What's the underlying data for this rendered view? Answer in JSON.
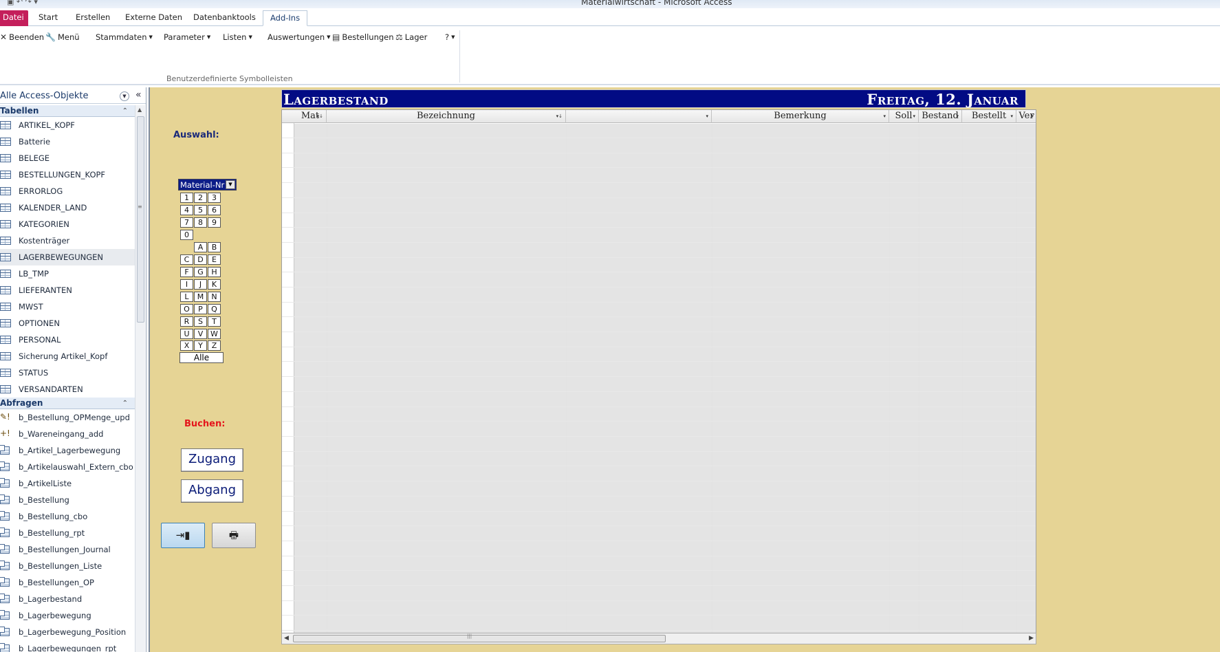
{
  "window": {
    "title": "Materialwirtschaft  -  Microsoft Access"
  },
  "ribbon_tabs": [
    "Datei",
    "Start",
    "Erstellen",
    "Externe Daten",
    "Datenbanktools",
    "Add-Ins"
  ],
  "ribbon": {
    "buttons": [
      {
        "label": "Beenden",
        "icon": "close-x-icon"
      },
      {
        "label": "Menü",
        "icon": "wrench-icon"
      },
      {
        "label": "Stammdaten",
        "dropdown": true
      },
      {
        "label": "Parameter",
        "dropdown": true
      },
      {
        "label": "Listen",
        "dropdown": true
      },
      {
        "label": "Auswertungen",
        "dropdown": true
      },
      {
        "label": "Bestellungen",
        "icon": "calculator-icon"
      },
      {
        "label": "Lager",
        "icon": "scales-icon"
      },
      {
        "label": "?",
        "dropdown": true
      }
    ],
    "group_label": "Benutzerdefinierte Symbolleisten"
  },
  "navpane": {
    "header": "Alle Access-Objekte",
    "sections": [
      {
        "label": "Tabellen",
        "items": [
          "ARTIKEL_KOPF",
          "Batterie",
          "BELEGE",
          "BESTELLUNGEN_KOPF",
          "ERRORLOG",
          "KALENDER_LAND",
          "KATEGORIEN",
          "Kostenträger",
          "LAGERBEWEGUNGEN",
          "LB_TMP",
          "LIEFERANTEN",
          "MWST",
          "OPTIONEN",
          "PERSONAL",
          "Sicherung Artikel_Kopf",
          "STATUS",
          "VERSANDARTEN"
        ],
        "highlighted": "LAGERBEWEGUNGEN"
      },
      {
        "label": "Abfragen",
        "items": [
          "b_Bestellung_OPMenge_upd",
          "b_Wareneingang_add",
          "b_Artikel_Lagerbewegung",
          "b_Artikelauswahl_Extern_cbo",
          "b_ArtikelListe",
          "b_Bestellung",
          "b_Bestellung_cbo",
          "b_Bestellung_rpt",
          "b_Bestellungen_Journal",
          "b_Bestellungen_Liste",
          "b_Bestellungen_OP",
          "b_Lagerbestand",
          "b_Lagerbewegung",
          "b_Lagerbewegung_Position",
          "b_Lagerbewegungen_rpt"
        ]
      }
    ]
  },
  "form": {
    "auswahl_label": "Auswahl:",
    "combo_label": "Material-Nr",
    "key_rows": [
      [
        "1",
        "2",
        "3"
      ],
      [
        "4",
        "5",
        "6"
      ],
      [
        "7",
        "8",
        "9"
      ],
      [
        "0"
      ],
      [
        "",
        "A",
        "B"
      ],
      [
        "C",
        "D",
        "E"
      ],
      [
        "F",
        "G",
        "H"
      ],
      [
        "I",
        "J",
        "K"
      ],
      [
        "L",
        "M",
        "N"
      ],
      [
        "O",
        "P",
        "Q"
      ],
      [
        "R",
        "S",
        "T"
      ],
      [
        "U",
        "V",
        "W"
      ],
      [
        "X",
        "Y",
        "Z"
      ]
    ],
    "alle_label": "Alle",
    "buchen_label": "Buchen:",
    "zugang_label": "Zugang",
    "abgang_label": "Abgang",
    "exit_icon": "exit-door-icon",
    "print_icon": "printer-icon"
  },
  "subform": {
    "title": "Lagerbestand",
    "date": "Freitag, 12. Januar",
    "columns": [
      {
        "label": "Mat",
        "sort": true
      },
      {
        "label": "Bezeichnung",
        "sort": true
      },
      {
        "label": "",
        "sort": false
      },
      {
        "label": "Bemerkung",
        "sort": false
      },
      {
        "label": "Soll",
        "sort": false
      },
      {
        "label": "Bestand",
        "sort": false
      },
      {
        "label": "Bestellt",
        "sort": false
      },
      {
        "label": "Ver",
        "sort": false
      }
    ]
  }
}
